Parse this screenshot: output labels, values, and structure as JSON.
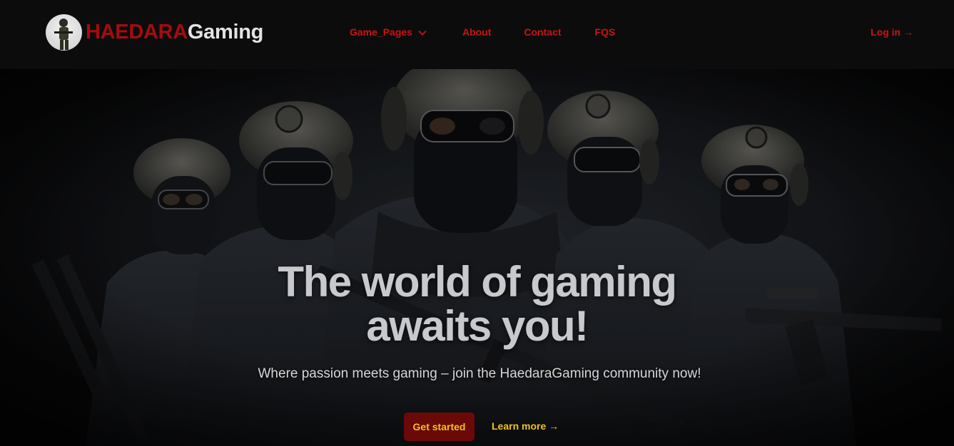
{
  "brand": {
    "name_red": "HAEDARA",
    "name_white": "Gaming"
  },
  "nav": {
    "items": [
      {
        "label": "Game_Pages",
        "icon": "chevron-down-icon"
      },
      {
        "label": "About"
      },
      {
        "label": "Contact"
      },
      {
        "label": "FQS"
      }
    ],
    "login_label": "Log in →"
  },
  "hero": {
    "title_line1": "The world of gaming",
    "title_line2": "awaits you!",
    "subtitle": "Where passion meets gaming – join the HaedaraGaming community now!",
    "primary_button": "Get started",
    "secondary_link": "Learn more →"
  },
  "colors": {
    "brand_red": "#a30d0d",
    "nav_link": "#c81414",
    "button_bg": "#6b0808",
    "accent_yellow": "#f0c419"
  }
}
